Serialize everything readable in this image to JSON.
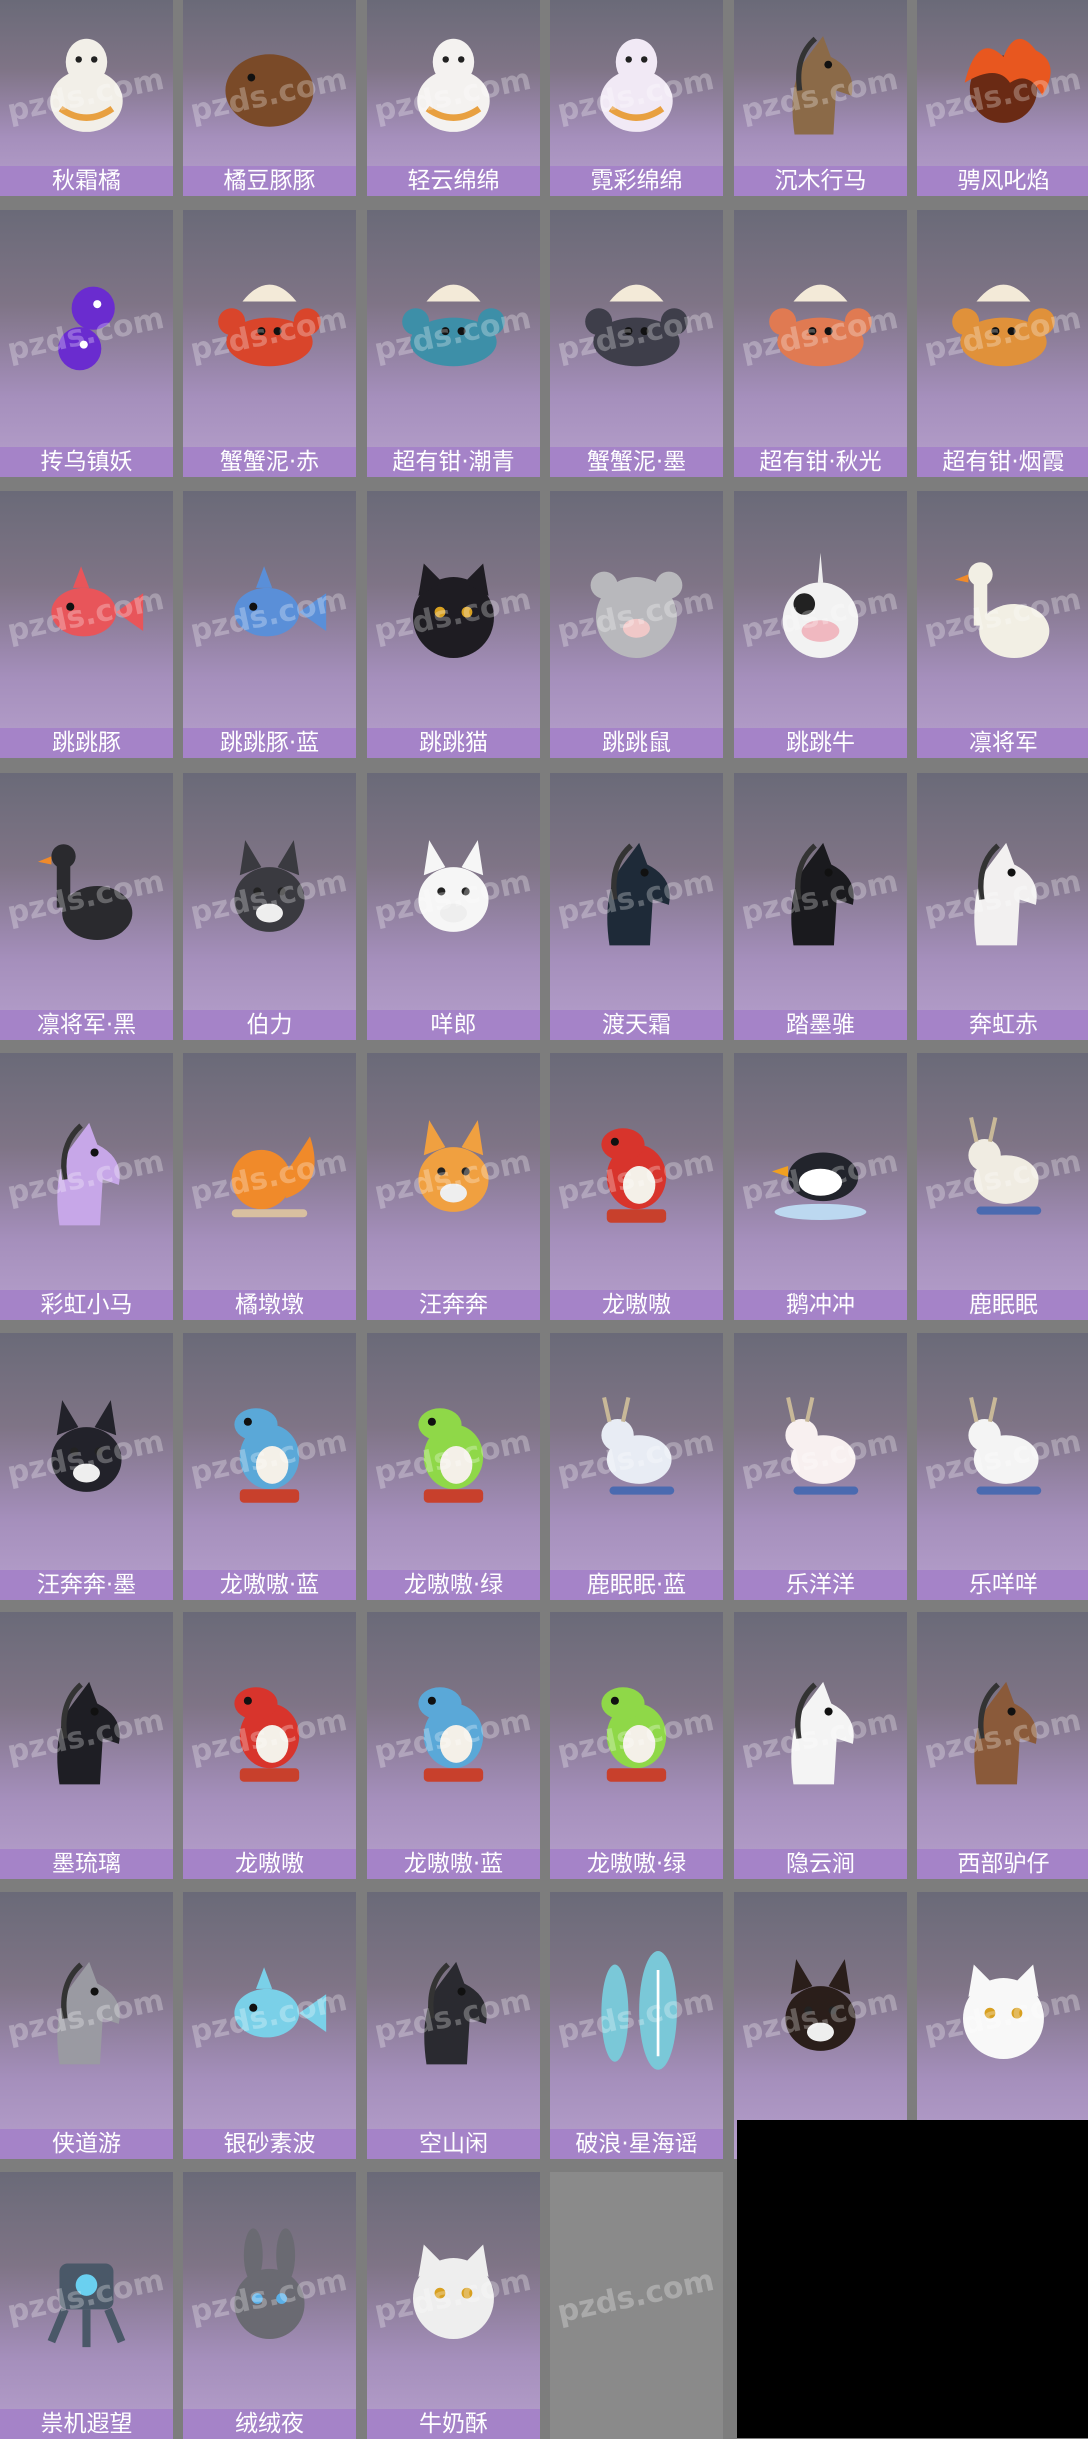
{
  "watermark": "pzds.com",
  "colors": {
    "background": "#7d7d7d",
    "label_bg": "#a583c8",
    "label_text": "#ffffff",
    "tile_top": "#6a6a78",
    "tile_bottom": "#b6a0cc"
  },
  "items": [
    {
      "name": "秋霜橘",
      "icon": "alpaca-icon",
      "tone": "#f2efe8"
    },
    {
      "name": "橘豆豚豚",
      "icon": "capybara-icon",
      "tone": "#7a4a28"
    },
    {
      "name": "轻云绵绵",
      "icon": "alpaca-icon",
      "tone": "#f4f2f0"
    },
    {
      "name": "霓彩绵绵",
      "icon": "alpaca-icon",
      "tone": "#f1e9f5"
    },
    {
      "name": "沉木行马",
      "icon": "horse-icon",
      "tone": "#8b6a48"
    },
    {
      "name": "骋风叱焰",
      "icon": "flame-icon",
      "tone": "#e8571f"
    },
    {
      "name": "抟乌镇妖",
      "icon": "bird-icon",
      "tone": "#6a2ccf"
    },
    {
      "name": "蟹蟹泥·赤",
      "icon": "crab-icon",
      "tone": "#d9452b"
    },
    {
      "name": "超有钳·潮青",
      "icon": "crab-icon",
      "tone": "#3d8fa8"
    },
    {
      "name": "蟹蟹泥·墨",
      "icon": "crab-icon",
      "tone": "#3e3e4a"
    },
    {
      "name": "超有钳·秋光",
      "icon": "crab-icon",
      "tone": "#e07a52"
    },
    {
      "name": "超有钳·烟霞",
      "icon": "crab-icon",
      "tone": "#e0913a"
    },
    {
      "name": "跳跳豚",
      "icon": "fish-icon",
      "tone": "#e8555a"
    },
    {
      "name": "跳跳豚·蓝",
      "icon": "fish-icon",
      "tone": "#5a8fd8"
    },
    {
      "name": "跳跳猫",
      "icon": "cat-icon",
      "tone": "#1e1c22"
    },
    {
      "name": "跳跳鼠",
      "icon": "mouse-icon",
      "tone": "#b8b8bc"
    },
    {
      "name": "跳跳牛",
      "icon": "cow-icon",
      "tone": "#f2f2f2"
    },
    {
      "name": "凛将军",
      "icon": "goose-icon",
      "tone": "#f2efe4"
    },
    {
      "name": "凛将军·黑",
      "icon": "goose-icon",
      "tone": "#2a2a2e"
    },
    {
      "name": "伯力",
      "icon": "husky-icon",
      "tone": "#3a3a40"
    },
    {
      "name": "咩郎",
      "icon": "dog-icon",
      "tone": "#f6f6f6"
    },
    {
      "name": "渡天霜",
      "icon": "horse-icon",
      "tone": "#1e2a38"
    },
    {
      "name": "踏墨骓",
      "icon": "horse-icon",
      "tone": "#1a1a1e"
    },
    {
      "name": "奔虹赤",
      "icon": "horse-icon",
      "tone": "#f2f0f0"
    },
    {
      "name": "彩虹小马",
      "icon": "pony-icon",
      "tone": "#c7a7e8"
    },
    {
      "name": "橘墩墩",
      "icon": "squirrel-icon",
      "tone": "#f08a2a"
    },
    {
      "name": "汪奔奔",
      "icon": "corgi-icon",
      "tone": "#f0a040"
    },
    {
      "name": "龙嗷嗷",
      "icon": "dino-icon",
      "tone": "#d8342c"
    },
    {
      "name": "鹅冲冲",
      "icon": "penguin-icon",
      "tone": "#22242c"
    },
    {
      "name": "鹿眠眠",
      "icon": "deer-icon",
      "tone": "#f0ece2"
    },
    {
      "name": "汪奔奔·墨",
      "icon": "corgi-icon",
      "tone": "#22222a"
    },
    {
      "name": "龙嗷嗷·蓝",
      "icon": "dino-icon",
      "tone": "#5aa8d8"
    },
    {
      "name": "龙嗷嗷·绿",
      "icon": "dino-icon",
      "tone": "#8fd848"
    },
    {
      "name": "鹿眠眠·蓝",
      "icon": "deer-icon",
      "tone": "#e8ecf4"
    },
    {
      "name": "乐洋洋",
      "icon": "sheep-icon",
      "tone": "#f8f0f0"
    },
    {
      "name": "乐咩咩",
      "icon": "sheep-icon",
      "tone": "#f4f4f4"
    },
    {
      "name": "墨琉璃",
      "icon": "horse-icon",
      "tone": "#1e1e24"
    },
    {
      "name": "龙嗷嗷",
      "icon": "dino-icon",
      "tone": "#d8342c"
    },
    {
      "name": "龙嗷嗷·蓝",
      "icon": "dino-icon",
      "tone": "#5aa8d8"
    },
    {
      "name": "龙嗷嗷·绿",
      "icon": "dino-icon",
      "tone": "#8fd848"
    },
    {
      "name": "隐云涧",
      "icon": "donkey-icon",
      "tone": "#f4f4f4"
    },
    {
      "name": "西部驴仔",
      "icon": "donkey-icon",
      "tone": "#8a5a3a"
    },
    {
      "name": "侠道游",
      "icon": "donkey-icon",
      "tone": "#9a9aa2"
    },
    {
      "name": "银砂素波",
      "icon": "fish-icon",
      "tone": "#7ad0e8"
    },
    {
      "name": "空山闲",
      "icon": "donkey-icon",
      "tone": "#2a2a30"
    },
    {
      "name": "破浪·星海谣",
      "icon": "surfboard-icon",
      "tone": "#7ac8d8"
    },
    {
      "name": "",
      "icon": "wolf-icon",
      "tone": "#2a1e1a"
    },
    {
      "name": "",
      "icon": "cat-icon",
      "tone": "#f8f8f8"
    },
    {
      "name": "祟机遐望",
      "icon": "mech-icon",
      "tone": "#4a5868"
    },
    {
      "name": "绒绒夜",
      "icon": "rabbit-icon",
      "tone": "#6a6a72"
    },
    {
      "name": "牛奶酥",
      "icon": "cat-icon",
      "tone": "#eeeeee"
    },
    {
      "name": "",
      "icon": "empty-icon",
      "tone": "#8a8a8a"
    }
  ]
}
